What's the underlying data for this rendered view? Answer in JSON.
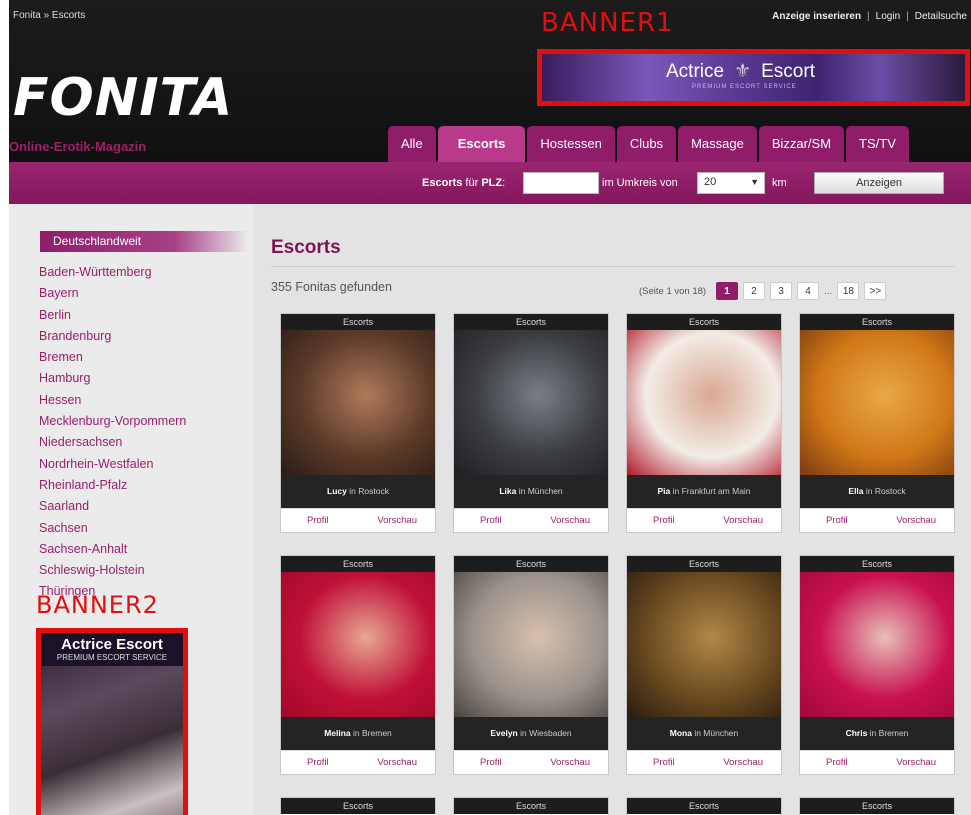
{
  "breadcrumb": "Fonita  »  Escorts",
  "toplinks": {
    "post_ad": "Anzeige inserieren",
    "login": "Login",
    "detail_search": "Detailsuche"
  },
  "logo": "FONITA",
  "tagline": "Online-Erotik-Magazin",
  "tabs": [
    {
      "label": "Alle",
      "active": false
    },
    {
      "label": "Escorts",
      "active": true
    },
    {
      "label": "Hostessen",
      "active": false
    },
    {
      "label": "Clubs",
      "active": false
    },
    {
      "label": "Massage",
      "active": false
    },
    {
      "label": "Bizzar/SM",
      "active": false
    },
    {
      "label": "TS/TV",
      "active": false
    }
  ],
  "search": {
    "label_prefix": "Escorts",
    "label_mid": " für ",
    "label_plz": "PLZ",
    "plz_value": "",
    "radius_label": "im Umkreis von",
    "radius_value": "20",
    "unit": "km",
    "submit_label": "Anzeigen"
  },
  "sidebar": {
    "heading": "Deutschlandweit",
    "regions": [
      "Baden-Württemberg",
      "Bayern",
      "Berlin",
      "Brandenburg",
      "Bremen",
      "Hamburg",
      "Hessen",
      "Mecklenburg-Vorpommern",
      "Niedersachsen",
      "Nordrhein-Westfalen",
      "Rheinland-Pfalz",
      "Saarland",
      "Sachsen",
      "Sachsen-Anhalt",
      "Schleswig-Holstein",
      "Thüringen"
    ]
  },
  "annotations": {
    "banner1_label": "BANNER1",
    "banner2_label": "BANNER2"
  },
  "banner1": {
    "title_left": "Actrice",
    "title_right": "Escort",
    "subtitle": "PREMIUM ESCORT SERVICE"
  },
  "banner2": {
    "title": "Actrice Escort",
    "subtitle": "PREMIUM ESCORT SERVICE"
  },
  "main": {
    "title": "Escorts",
    "found": "355 Fonitas gefunden",
    "pager": {
      "info": "(Seite 1 von 18)",
      "pages": [
        "1",
        "2",
        "3",
        "4"
      ],
      "ellipsis": "...",
      "last": "18",
      "next": ">>"
    }
  },
  "cards": [
    {
      "category": "Escorts",
      "name": "Lucy",
      "city": "in Rostock",
      "profile": "Profil",
      "preview": "Vorschau",
      "photo_colors": [
        "#5a3a28",
        "#b07a5a",
        "#2a1c18"
      ]
    },
    {
      "category": "Escorts",
      "name": "Lika",
      "city": "in München",
      "profile": "Profil",
      "preview": "Vorschau",
      "photo_colors": [
        "#3a3c40",
        "#7a7e86",
        "#1e2024"
      ]
    },
    {
      "category": "Escorts",
      "name": "Pia",
      "city": "in Frankfurt am Main",
      "profile": "Profil",
      "preview": "Vorschau",
      "photo_colors": [
        "#f2ece6",
        "#d9a890",
        "#b01828"
      ]
    },
    {
      "category": "Escorts",
      "name": "Ella",
      "city": "in Rostock",
      "profile": "Profil",
      "preview": "Vorschau",
      "photo_colors": [
        "#d07818",
        "#e8a848",
        "#7a3a10"
      ]
    },
    {
      "category": "Escorts",
      "name": "Melina",
      "city": "in Bremen",
      "profile": "Profil",
      "preview": "Vorschau",
      "photo_colors": [
        "#c01038",
        "#e8a890",
        "#a00828"
      ]
    },
    {
      "category": "Escorts",
      "name": "Evelyn",
      "city": "in Wiesbaden",
      "profile": "Profil",
      "preview": "Vorschau",
      "photo_colors": [
        "#9a928c",
        "#d8c0ac",
        "#4a4440"
      ]
    },
    {
      "category": "Escorts",
      "name": "Mona",
      "city": "in München",
      "profile": "Profil",
      "preview": "Vorschau",
      "photo_colors": [
        "#6a4a20",
        "#b08848",
        "#2a1c10"
      ]
    },
    {
      "category": "Escorts",
      "name": "Chris",
      "city": "in Bremen",
      "profile": "Profil",
      "preview": "Vorschau",
      "photo_colors": [
        "#c81050",
        "#e8c0b8",
        "#a0083c"
      ]
    },
    {
      "category": "Escorts"
    },
    {
      "category": "Escorts"
    },
    {
      "category": "Escorts"
    },
    {
      "category": "Escorts"
    }
  ]
}
